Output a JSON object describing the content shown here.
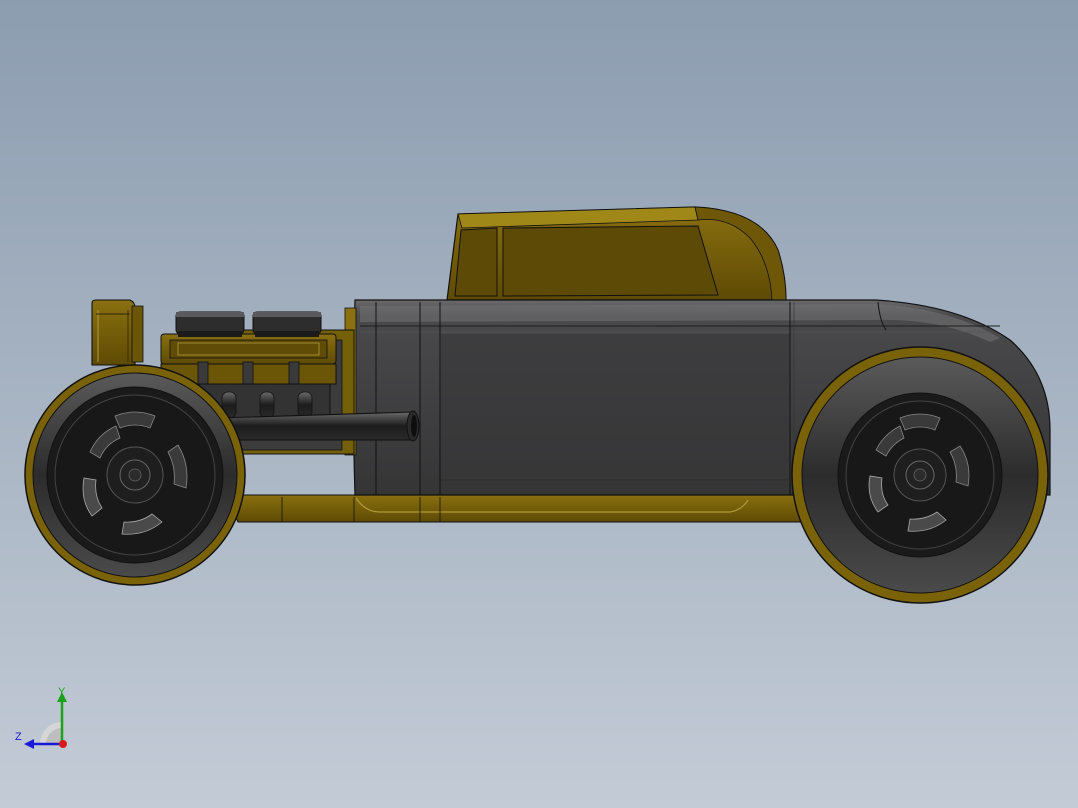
{
  "viewport": {
    "background_top": "#8c9db0",
    "background_bottom": "#c3cbd6"
  },
  "model": {
    "name": "hot-rod-coupe",
    "colors": {
      "gold": "#7a6208",
      "gold_light": "#a48a1e",
      "gold_dark": "#4a3a02",
      "body": "#3f3f40",
      "body_light": "#5d5d5f",
      "tire": "#2b2b2c",
      "rim": "#141414",
      "edge": "#111111"
    }
  },
  "triad": {
    "y_label": "Y",
    "z_label": "Z",
    "y_color": "#1aa31a",
    "z_color": "#1a1ad6",
    "x_color": "#d61a1a"
  }
}
